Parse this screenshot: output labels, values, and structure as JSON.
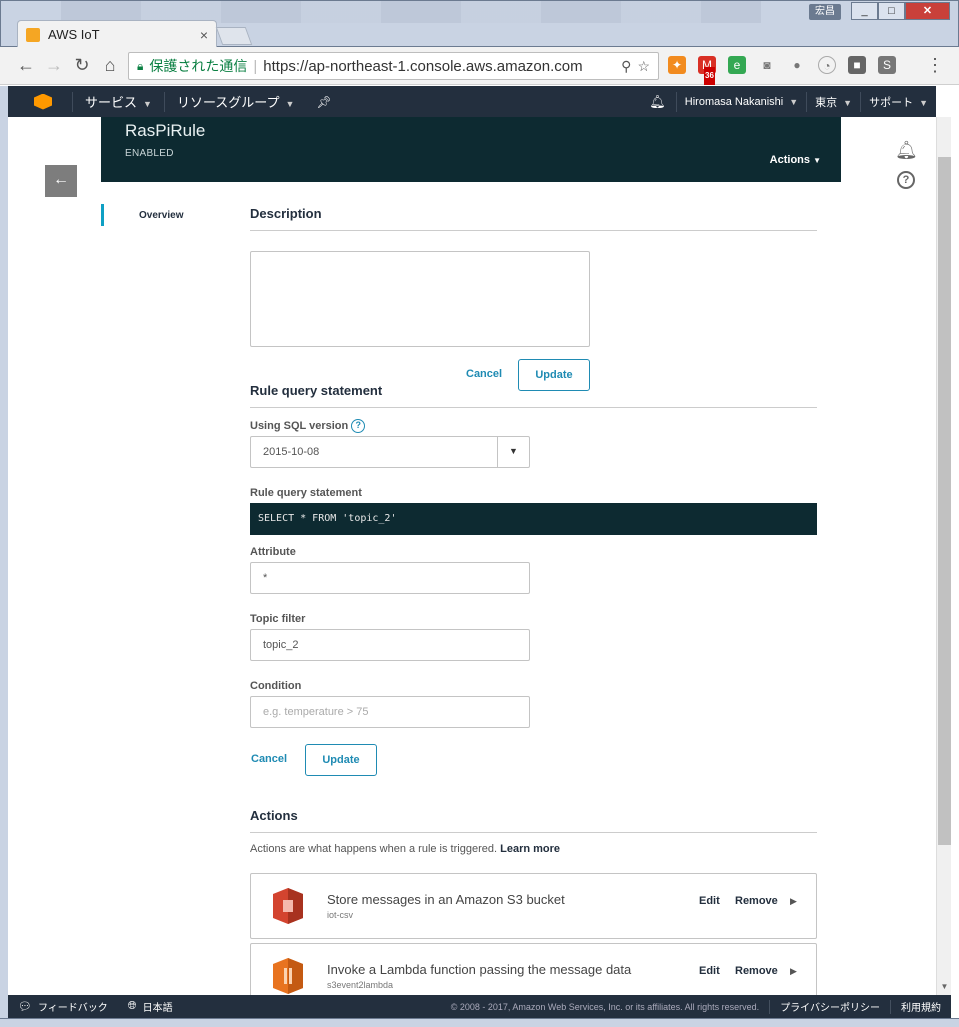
{
  "window": {
    "tab_title": "AWS IoT",
    "tab_close": "×",
    "user_badge": "宏昌",
    "minimize": "_",
    "maximize": "□",
    "close": "✕"
  },
  "browser": {
    "back": "←",
    "forward": "→",
    "reload": "↻",
    "home": "⌂",
    "secure_text": "保護された通信",
    "url": "https://ap-northeast-1.console.aws.amazon.com",
    "gmail_count": "36",
    "menu": "⋮"
  },
  "aws_nav": {
    "services": "サービス",
    "resource_groups": "リソースグループ",
    "user": "Hiromasa Nakanishi",
    "region": "東京",
    "support": "サポート"
  },
  "rule": {
    "name": "RasPiRule",
    "status": "ENABLED",
    "actions_label": "Actions"
  },
  "left_nav": {
    "overview": "Overview"
  },
  "description": {
    "title": "Description",
    "cancel": "Cancel",
    "update": "Update"
  },
  "query": {
    "title": "Rule query statement",
    "sql_version_label": "Using SQL version",
    "sql_version_value": "2015-10-08",
    "statement_label": "Rule query statement",
    "statement_value": "SELECT * FROM 'topic_2'",
    "attribute_label": "Attribute",
    "attribute_value": "*",
    "topic_filter_label": "Topic filter",
    "topic_filter_value": "topic_2",
    "condition_label": "Condition",
    "condition_placeholder": "e.g. temperature > 75",
    "cancel": "Cancel",
    "update": "Update"
  },
  "actions_section": {
    "title": "Actions",
    "description": "Actions are what happens when a rule is triggered.",
    "learn_more": "Learn more",
    "items": [
      {
        "title": "Store messages in an Amazon S3 bucket",
        "sub": "iot-csv",
        "edit": "Edit",
        "remove": "Remove",
        "color": "#d3442f"
      },
      {
        "title": "Invoke a Lambda function passing the message data",
        "sub": "s3event2lambda",
        "edit": "Edit",
        "remove": "Remove",
        "color": "#e8731f"
      }
    ]
  },
  "footer": {
    "feedback": "フィードバック",
    "language": "日本語",
    "copyright": "© 2008 - 2017, Amazon Web Services, Inc. or its affiliates. All rights reserved.",
    "privacy": "プライバシーポリシー",
    "terms": "利用規約"
  }
}
